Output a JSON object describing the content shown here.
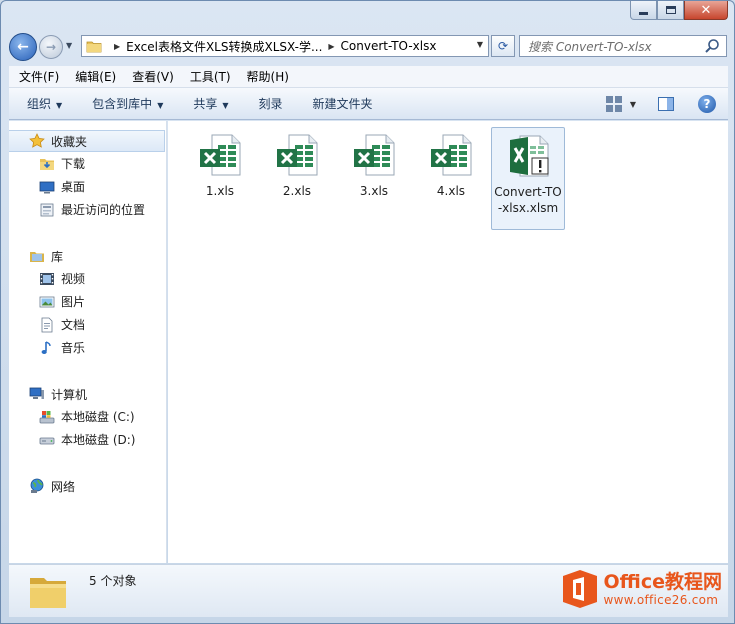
{
  "window": {
    "controls": {
      "minimize": "—",
      "maximize": "☐",
      "close": "✕"
    }
  },
  "address": {
    "crumbs": [
      "Excel表格文件XLS转换成XLSX-学...",
      "Convert-TO-xlsx"
    ]
  },
  "search": {
    "placeholder": "搜索 Convert-TO-xlsx"
  },
  "menubar": {
    "items": [
      "文件(F)",
      "编辑(E)",
      "查看(V)",
      "工具(T)",
      "帮助(H)"
    ]
  },
  "toolbar": {
    "items": [
      "组织",
      "包含到库中",
      "共享",
      "刻录",
      "新建文件夹"
    ]
  },
  "navpane": {
    "favorites": {
      "label": "收藏夹",
      "items": [
        "下载",
        "桌面",
        "最近访问的位置"
      ]
    },
    "libraries": {
      "label": "库",
      "items": [
        "视频",
        "图片",
        "文档",
        "音乐"
      ]
    },
    "computer": {
      "label": "计算机",
      "items": [
        "本地磁盘 (C:)",
        "本地磁盘 (D:)"
      ]
    },
    "network": {
      "label": "网络"
    }
  },
  "files": [
    {
      "name": "1.xls",
      "icon": "excel-xls-icon"
    },
    {
      "name": "2.xls",
      "icon": "excel-xls-icon"
    },
    {
      "name": "3.xls",
      "icon": "excel-xls-icon"
    },
    {
      "name": "4.xls",
      "icon": "excel-xls-icon"
    },
    {
      "name": "Convert-TO-xlsx.xlsm",
      "icon": "excel-xlsm-icon",
      "selected": true
    }
  ],
  "status": {
    "count_text": "5 个对象"
  },
  "watermark": {
    "brand": "Office教程网",
    "url": "www.office26.com"
  },
  "colors": {
    "excel_green": "#217346",
    "accent_blue": "#2860b8",
    "watermark_orange": "#e8561c"
  }
}
